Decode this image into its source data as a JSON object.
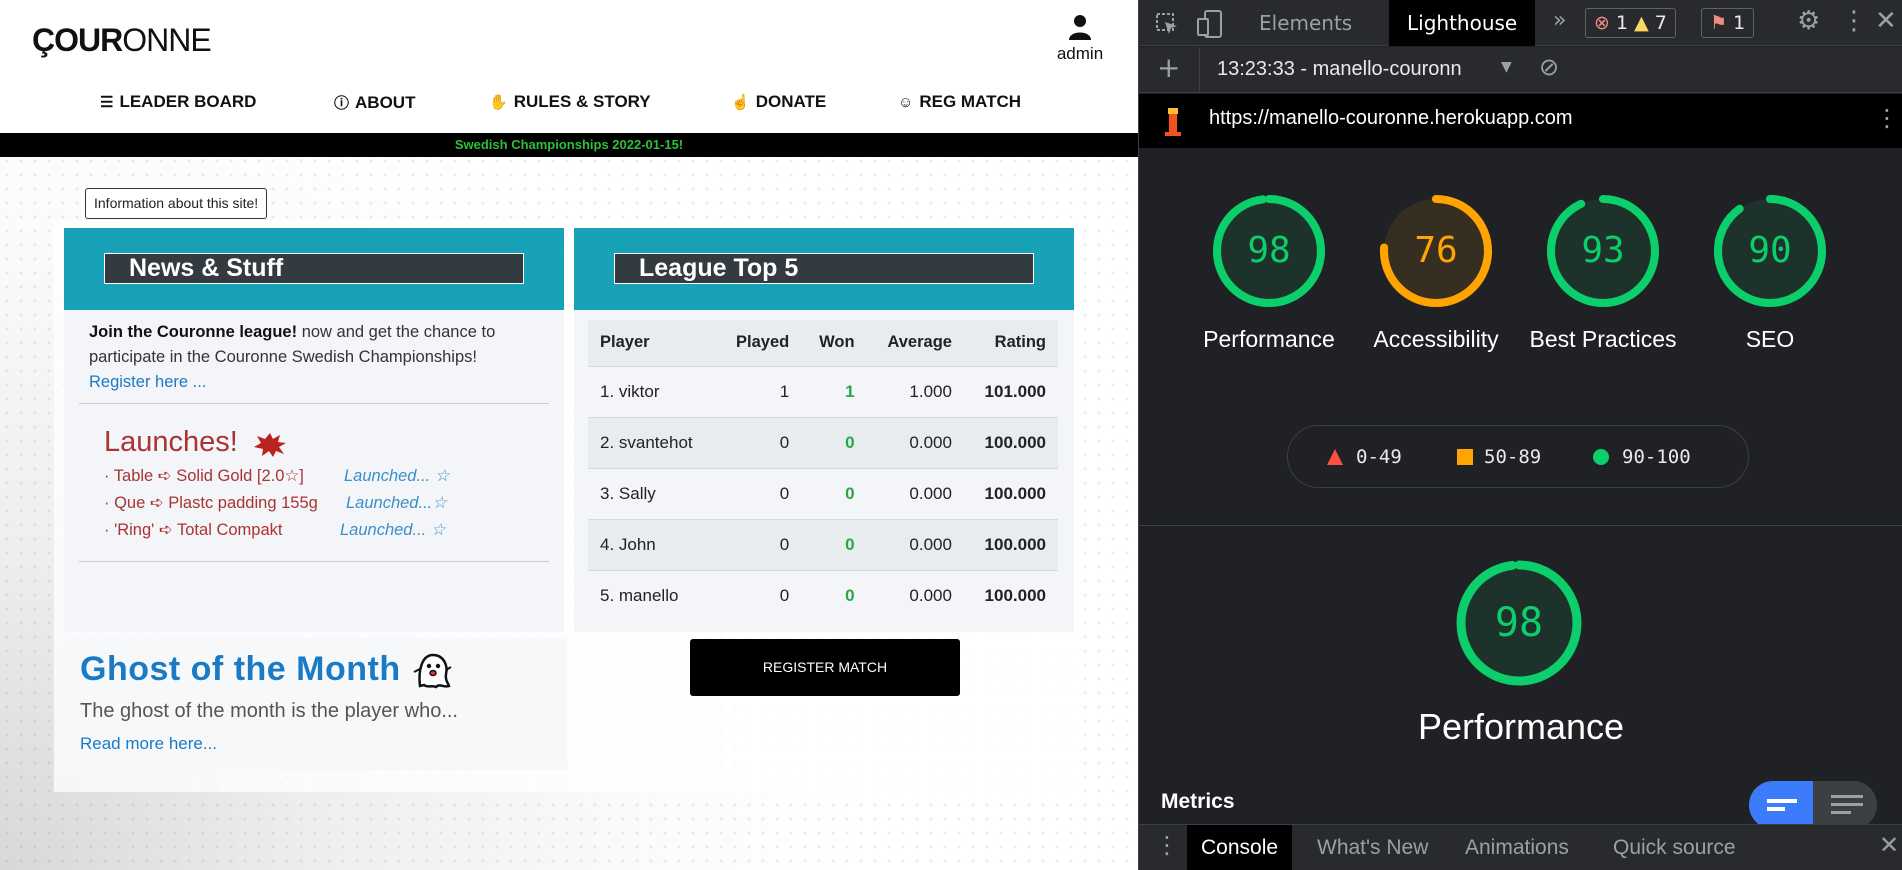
{
  "site": {
    "logo_bold": "ÇOUR",
    "logo_light": "ONNE",
    "user_label": "admin",
    "nav": [
      {
        "label": "LEADER BOARD",
        "icon": "list-icon"
      },
      {
        "label": "ABOUT",
        "icon": "info-icon"
      },
      {
        "label": "RULES & STORY",
        "icon": "handshake-icon"
      },
      {
        "label": "DONATE",
        "icon": "donate-icon"
      },
      {
        "label": "REG MATCH",
        "icon": "mask-icon"
      }
    ],
    "ticker": "Swedish Championships 2022-01-15!",
    "info_button": "Information about this site!",
    "news": {
      "title": "News & Stuff",
      "lead_bold": "Join the Couronne league!",
      "lead_rest": " now and get the chance to participate in the Couronne Swedish Championships!",
      "register_link": "Register here ...",
      "launches_title": "Launches!",
      "launches": [
        {
          "text": "· Table ➪ Solid Gold [2.0☆]",
          "tag": "Launched... ☆"
        },
        {
          "text": "· Que ➪ Plastc padding 155g",
          "tag": "Launched...☆"
        },
        {
          "text": "· 'Ring' ➪ Total Compakt",
          "tag": "Launched... ☆"
        }
      ]
    },
    "league": {
      "title": "League Top 5",
      "headers": [
        "Player",
        "Played",
        "Won",
        "Average",
        "Rating"
      ],
      "rows": [
        [
          "1. viktor",
          "1",
          "1",
          "1.000",
          "101.000"
        ],
        [
          "2. svantehot",
          "0",
          "0",
          "0.000",
          "100.000"
        ],
        [
          "3. Sally",
          "0",
          "0",
          "0.000",
          "100.000"
        ],
        [
          "4. John",
          "0",
          "0",
          "0.000",
          "100.000"
        ],
        [
          "5. manello",
          "0",
          "0",
          "0.000",
          "100.000"
        ]
      ]
    },
    "ghost": {
      "title": "Ghost of the Month",
      "text": "The ghost of the month is the player who...",
      "link": "Read more here..."
    },
    "register_match": "REGISTER MATCH",
    "colors": {
      "teal": "#17a2b8",
      "dark": "#333a40",
      "link": "#1a7ac4",
      "launch": "#aa3333",
      "won": "#28a745",
      "ticker": "#2fbf3a"
    }
  },
  "devtools": {
    "tabs": [
      "Elements",
      "Lighthouse"
    ],
    "active_tab": "Lighthouse",
    "errors": "1",
    "warnings": "7",
    "issues": "1",
    "report_label": "13:23:33 - manello-couronn",
    "url": "https://manello-couronne.herokuapp.com",
    "scores": [
      {
        "label": "Performance",
        "value": 98,
        "color": "#0cce6b"
      },
      {
        "label": "Accessibility",
        "value": 76,
        "color": "#ffa400"
      },
      {
        "label": "Best Practices",
        "value": 93,
        "color": "#0cce6b"
      },
      {
        "label": "SEO",
        "value": 90,
        "color": "#0cce6b"
      }
    ],
    "legend": [
      "0-49",
      "50-89",
      "90-100"
    ],
    "main_score": {
      "label": "Performance",
      "value": 98
    },
    "metrics_label": "Metrics",
    "drawer_tabs": [
      "Console",
      "What's New",
      "Animations",
      "Quick source"
    ]
  }
}
